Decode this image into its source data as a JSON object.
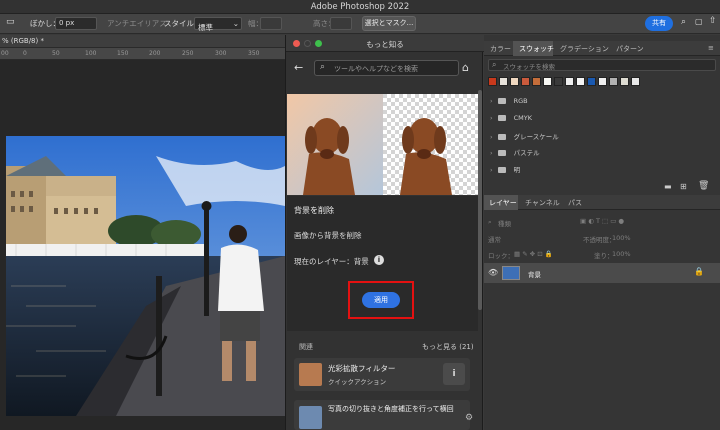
{
  "app": {
    "title": "Adobe Photoshop 2022"
  },
  "options_bar": {
    "feather_label": "ぼかし：",
    "feather_value": "0 px",
    "antialias_label": "アンチエイリアス",
    "style_label": "スタイル：",
    "style_value": "標準",
    "width_label": "幅：",
    "height_label": "高さ：",
    "select_mask_label": "選択とマスク...",
    "share_label": "共有"
  },
  "document": {
    "tab_label": "% (RGB/8) *",
    "ruler_ticks": [
      "00",
      "0",
      "50",
      "100",
      "150",
      "200",
      "250",
      "300",
      "350"
    ]
  },
  "learn_panel": {
    "title": "もっと知る",
    "search_placeholder": "ツールやヘルプなどを検索",
    "heading": "背景を削除",
    "description": "画像から背景を削除",
    "current_layer": "現在のレイヤー：背景",
    "apply_label": "適用",
    "related_label": "関連",
    "more_label": "もっと見る (21)",
    "cards": [
      {
        "title": "光彩拡散フィルター",
        "subtitle": "クイックアクション"
      },
      {
        "title": "写真の切り抜きと角度補正を行って横回",
        "subtitle": ""
      }
    ]
  },
  "swatch_panel": {
    "tabs": [
      "カラー",
      "スウォッチ",
      "グラデーション",
      "パターン"
    ],
    "search_placeholder": "スウォッチを検索",
    "colors": [
      "#c8391c",
      "#e7e2da",
      "#f0d8c0",
      "#ca5a3c",
      "#c46d3a",
      "#f8f8f4",
      "#3a3a3a",
      "#eeeeee",
      "#f5f5f5",
      "#1a59b0",
      "#f0f0f0",
      "#b2b2b2",
      "#dedcd2",
      "#e8e8e8"
    ],
    "groups": [
      "RGB",
      "CMYK",
      "グレースケール",
      "パステル",
      "明"
    ]
  },
  "layers_panel": {
    "tabs": [
      "レイヤー",
      "チャンネル",
      "パス"
    ],
    "kind_label": "種類",
    "blend_label": "通常",
    "opacity_label": "不透明度：",
    "opacity_value": "100%",
    "lock_label": "ロック：",
    "fill_label": "塗り：",
    "fill_value": "100%",
    "layer_name": "背景"
  }
}
